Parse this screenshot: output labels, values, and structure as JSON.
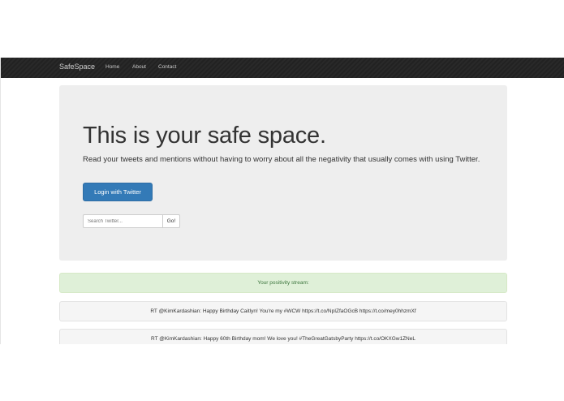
{
  "navbar": {
    "brand": "SafeSpace",
    "links": [
      "Home",
      "About",
      "Contact"
    ]
  },
  "hero": {
    "title": "This is your safe space.",
    "text": "Read your tweets and mentions without having to worry about all the negativity that usually comes with using Twitter.",
    "login_label": "Login with Twitter"
  },
  "search": {
    "placeholder": "Search Twitter...",
    "button_label": "Go!"
  },
  "stream": {
    "header": "Your positivity stream:",
    "tweets": [
      "RT @KimKardashian: Happy Birthday Caitlyn! You're my #WCW https://t.co/NpIZfaOGcB https://t.co/mey0hhzmXf",
      "RT @KimKardashian: Happy 60th Birthday mom! We love you! #TheGreatGatsbyParty https://t.co/OKXGw1ZNeL"
    ]
  },
  "colors": {
    "navbar": "#222222",
    "primary": "#337ab7",
    "jumbotron": "#eeeeee",
    "success_bg": "#dff0d8",
    "success_text": "#3c763d"
  }
}
